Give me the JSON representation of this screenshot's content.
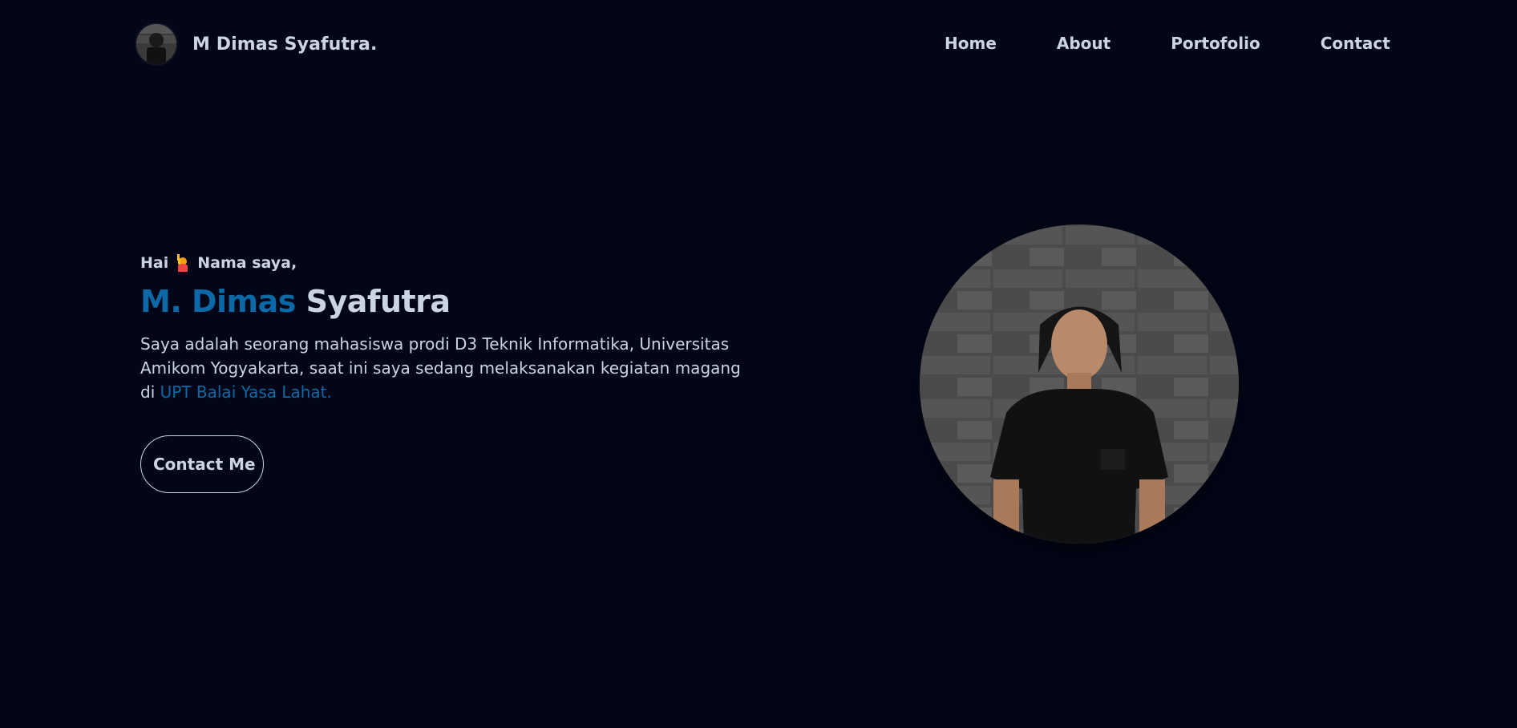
{
  "header": {
    "brand_name": "M Dimas Syafutra.",
    "nav": [
      "Home",
      "About",
      "Portofolio",
      "Contact"
    ]
  },
  "hero": {
    "greeting_hai": "Hai",
    "greeting_rest": "Nama saya,",
    "name_first": "M. Dimas",
    "name_last": "Syafutra",
    "description": "Saya adalah seorang mahasiswa prodi D3 Teknik Informatika, Universitas Amikom Yogyakarta, saat ini saya sedang melaksanakan kegiatan magang di",
    "description_highlight": "UPT Balai Yasa Lahat.",
    "button_label": "Contact Me"
  },
  "colors": {
    "background": "#020617",
    "accent": "#0b69a8",
    "text": "#cbd5e1"
  },
  "icons": {
    "greeting_emoji": "raising-hand-emoji"
  }
}
